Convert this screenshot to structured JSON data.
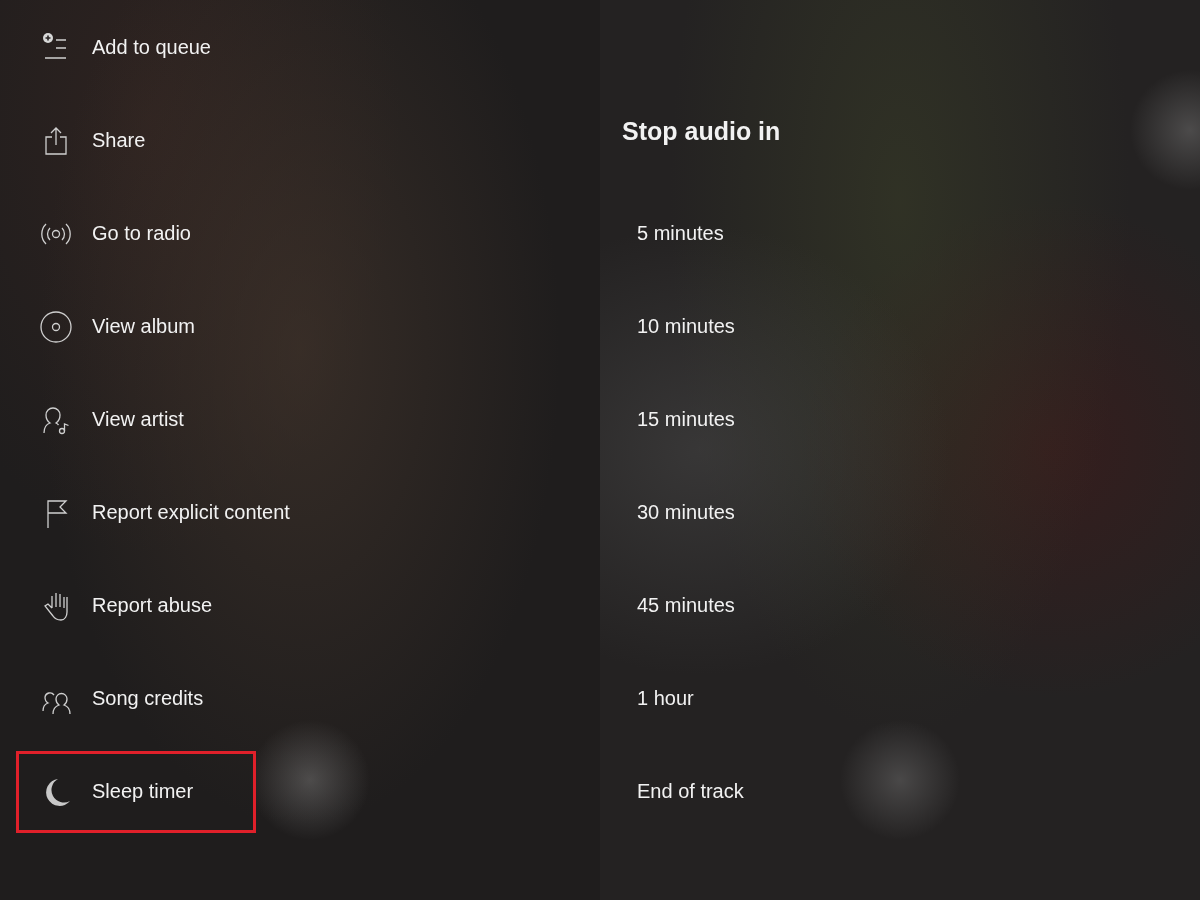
{
  "menu": {
    "items": [
      {
        "label": "Add to queue",
        "kind": "queue",
        "highlighted": false
      },
      {
        "label": "Share",
        "kind": "share",
        "highlighted": false
      },
      {
        "label": "Go to radio",
        "kind": "radio",
        "highlighted": false
      },
      {
        "label": "View album",
        "kind": "album",
        "highlighted": false
      },
      {
        "label": "View artist",
        "kind": "artist",
        "highlighted": false
      },
      {
        "label": "Report explicit content",
        "kind": "flag",
        "highlighted": false
      },
      {
        "label": "Report abuse",
        "kind": "hand",
        "highlighted": false
      },
      {
        "label": "Song credits",
        "kind": "credits",
        "highlighted": false
      },
      {
        "label": "Sleep timer",
        "kind": "moon",
        "highlighted": true
      }
    ]
  },
  "sleep_timer": {
    "title": "Stop audio in",
    "options": [
      {
        "label": "5 minutes"
      },
      {
        "label": "10 minutes"
      },
      {
        "label": "15 minutes"
      },
      {
        "label": "30 minutes"
      },
      {
        "label": "45 minutes"
      },
      {
        "label": "1 hour"
      },
      {
        "label": "End of track"
      }
    ]
  }
}
